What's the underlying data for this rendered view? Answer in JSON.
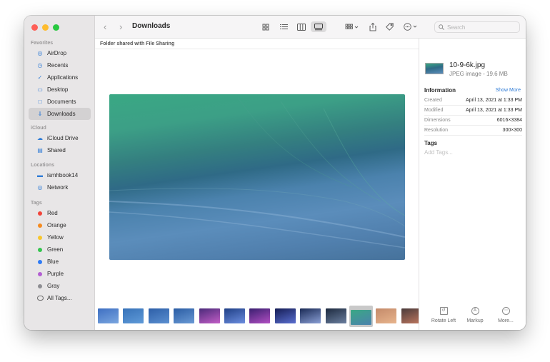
{
  "window": {
    "title": "Downloads"
  },
  "sidebar": {
    "favorites_header": "Favorites",
    "favorites": [
      {
        "label": "AirDrop",
        "icon": "airdrop-icon"
      },
      {
        "label": "Recents",
        "icon": "clock-icon"
      },
      {
        "label": "Applications",
        "icon": "applications-icon"
      },
      {
        "label": "Desktop",
        "icon": "desktop-icon"
      },
      {
        "label": "Documents",
        "icon": "document-icon"
      },
      {
        "label": "Downloads",
        "icon": "download-icon",
        "active": true
      }
    ],
    "icloud_header": "iCloud",
    "icloud": [
      {
        "label": "iCloud Drive",
        "icon": "cloud-icon"
      },
      {
        "label": "Shared",
        "icon": "shared-folder-icon"
      }
    ],
    "locations_header": "Locations",
    "locations": [
      {
        "label": "ismhbook14",
        "icon": "laptop-icon"
      },
      {
        "label": "Network",
        "icon": "globe-icon"
      }
    ],
    "tags_header": "Tags",
    "tags": [
      {
        "label": "Red",
        "color": "#f2443a"
      },
      {
        "label": "Orange",
        "color": "#f58b1f"
      },
      {
        "label": "Yellow",
        "color": "#f8c62c"
      },
      {
        "label": "Green",
        "color": "#35c54f"
      },
      {
        "label": "Blue",
        "color": "#2f7bf5"
      },
      {
        "label": "Purple",
        "color": "#b35fd2"
      },
      {
        "label": "Gray",
        "color": "#8e8e93"
      },
      {
        "label": "All Tags...",
        "color": ""
      }
    ]
  },
  "toolbar": {
    "view_modes": [
      "icon-view-icon",
      "list-view-icon",
      "column-view-icon",
      "gallery-view-icon"
    ],
    "selected_view": "gallery-view-icon",
    "search_placeholder": "Search"
  },
  "pathbar": {
    "text": "Folder shared with File Sharing"
  },
  "inspector": {
    "file_name": "10-9-6k.jpg",
    "file_desc": "JPEG image - 19.6 MB",
    "info_header": "Information",
    "show_more": "Show More",
    "rows": [
      {
        "key": "Created",
        "value": "April 13, 2021 at 1:33 PM"
      },
      {
        "key": "Modified",
        "value": "April 13, 2021 at 1:33 PM"
      },
      {
        "key": "Dimensions",
        "value": "6016×3384"
      },
      {
        "key": "Resolution",
        "value": "300×300"
      }
    ],
    "tags_header": "Tags",
    "tags_placeholder": "Add Tags...",
    "actions": [
      {
        "label": "Rotate Left",
        "icon": "rotate-left-icon"
      },
      {
        "label": "Markup",
        "icon": "markup-icon"
      },
      {
        "label": "More...",
        "icon": "more-icon"
      }
    ]
  },
  "filmstrip": {
    "selected_index": 10,
    "thumbs": [
      {
        "colors": [
          "#3e6fc2",
          "#7aa6df"
        ]
      },
      {
        "colors": [
          "#3772b8",
          "#5f9ad8"
        ]
      },
      {
        "colors": [
          "#2d5fa8",
          "#5b8fd0"
        ]
      },
      {
        "colors": [
          "#2a5ca3",
          "#6a9ad5"
        ]
      },
      {
        "colors": [
          "#4b2a7a",
          "#c35ec7"
        ]
      },
      {
        "colors": [
          "#1f3f85",
          "#6c8ee0"
        ]
      },
      {
        "colors": [
          "#3a1f70",
          "#b24fc3"
        ]
      },
      {
        "colors": [
          "#151d55",
          "#5a6fd0"
        ]
      },
      {
        "colors": [
          "#1a2a55",
          "#8a9fd5"
        ]
      },
      {
        "colors": [
          "#1d2a3f",
          "#6b7f9f"
        ]
      },
      {
        "colors": [
          "#3aa884",
          "#4b82ad"
        ]
      },
      {
        "colors": [
          "#c48a6a",
          "#e7b48c"
        ]
      },
      {
        "colors": [
          "#4a3a3a",
          "#c0785f"
        ]
      }
    ]
  }
}
